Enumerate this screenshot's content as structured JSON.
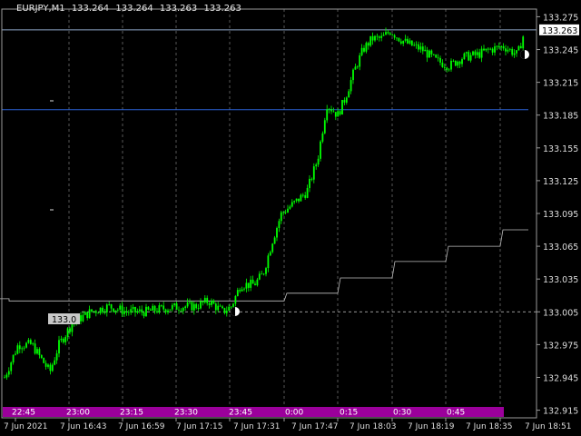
{
  "symbol_info": {
    "symbol": "EURJPY,M1",
    "ohlc": [
      "133.264",
      "133.264",
      "133.263",
      "133.263"
    ]
  },
  "current_price_label": "133.263",
  "level_label": "133.0",
  "colors": {
    "background": "#000000",
    "candles": "#00ff00",
    "grid": "#6e6e6e",
    "bid_line": "#8ea6c8",
    "hline": "#2b63d6",
    "step_line": "#bdbdbd",
    "session_bar": "#9b009b",
    "price_tag_bg": "#ffffff",
    "price_tag_fg": "#000000",
    "level_tag_bg": "#c8c8c8"
  },
  "chart_data": {
    "type": "candlestick",
    "price_axis": {
      "ticks": [
        "133.275",
        "133.245",
        "133.215",
        "133.185",
        "133.155",
        "133.125",
        "133.095",
        "133.065",
        "133.035",
        "133.005",
        "132.975",
        "132.945",
        "132.915"
      ],
      "range": [
        132.908,
        133.282
      ]
    },
    "time_axis": {
      "ticks": [
        "7 Jun 2021",
        "7 Jun 16:43",
        "7 Jun 16:59",
        "7 Jun 17:15",
        "7 Jun 17:31",
        "7 Jun 17:47",
        "7 Jun 18:03",
        "7 Jun 18:19",
        "7 Jun 18:35",
        "7 Jun 18:51"
      ]
    },
    "session_labels": [
      "22:45",
      "23:00",
      "23:15",
      "23:30",
      "23:45",
      "0:00",
      "0:15",
      "0:30",
      "0:45"
    ],
    "horizontal_lines": {
      "bid": 133.263,
      "upper": 133.19,
      "lower_dashed": 133.005
    },
    "step_line": [
      [
        0,
        133.017
      ],
      [
        10,
        133.017
      ],
      [
        10,
        133.015
      ],
      [
        313,
        133.015
      ],
      [
        316,
        133.022
      ],
      [
        372,
        133.022
      ],
      [
        375,
        133.036
      ],
      [
        432,
        133.036
      ],
      [
        435,
        133.051
      ],
      [
        491,
        133.051
      ],
      [
        494,
        133.065
      ],
      [
        551,
        133.065
      ],
      [
        554,
        133.08
      ],
      [
        582,
        133.08
      ]
    ],
    "price_path": [
      [
        5,
        132.945
      ],
      [
        20,
        132.975
      ],
      [
        35,
        132.975
      ],
      [
        55,
        132.95
      ],
      [
        65,
        132.975
      ],
      [
        80,
        132.995
      ],
      [
        100,
        133.005
      ],
      [
        120,
        133.01
      ],
      [
        140,
        133.005
      ],
      [
        160,
        133.005
      ],
      [
        180,
        133.008
      ],
      [
        200,
        133.01
      ],
      [
        215,
        133.01
      ],
      [
        230,
        133.015
      ],
      [
        245,
        133.005
      ],
      [
        255,
        133.01
      ],
      [
        265,
        133.03
      ],
      [
        280,
        133.03
      ],
      [
        290,
        133.04
      ],
      [
        300,
        133.07
      ],
      [
        310,
        133.095
      ],
      [
        325,
        133.105
      ],
      [
        338,
        133.115
      ],
      [
        350,
        133.145
      ],
      [
        360,
        133.195
      ],
      [
        372,
        133.185
      ],
      [
        380,
        133.2
      ],
      [
        390,
        133.225
      ],
      [
        400,
        133.245
      ],
      [
        410,
        133.255
      ],
      [
        420,
        133.255
      ],
      [
        430,
        133.262
      ],
      [
        440,
        133.255
      ],
      [
        450,
        133.25
      ],
      [
        465,
        133.245
      ],
      [
        480,
        133.235
      ],
      [
        495,
        133.23
      ],
      [
        510,
        133.238
      ],
      [
        525,
        133.24
      ],
      [
        540,
        133.245
      ],
      [
        555,
        133.248
      ],
      [
        570,
        133.24
      ],
      [
        578,
        133.262
      ]
    ]
  }
}
